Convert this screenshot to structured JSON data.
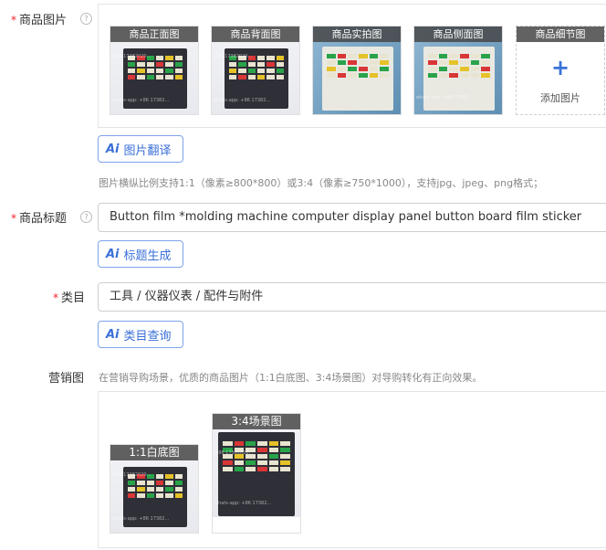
{
  "product_images": {
    "label": "商品图片",
    "help": "?",
    "items": [
      {
        "label": "商品正面图",
        "style": "white"
      },
      {
        "label": "商品背面图",
        "style": "white"
      },
      {
        "label": "商品实拍图",
        "style": "blue"
      },
      {
        "label": "商品侧面图",
        "style": "blue"
      }
    ],
    "add_tile": {
      "head": "商品细节图",
      "plus": "+",
      "text": "添加图片"
    },
    "translate_button": "图片翻译",
    "tip": "图片横纵比例支持1:1（像素≥800*800）或3:4（像素≥750*1000），支持jpg、jpeg、png格式；"
  },
  "title_field": {
    "label": "商品标题",
    "help": "?",
    "value": "Button film *molding machine computer display panel button board film sticker",
    "generate_button": "标题生成"
  },
  "category_field": {
    "label": "类目",
    "value": "工具 / 仪器仪表 / 配件与附件",
    "query_button": "类目查询"
  },
  "marketing": {
    "label": "营销图",
    "tip": "在营销导购场景，优质的商品图片（1:1白底图、3:4场景图）对导购转化有正向效果。",
    "images": [
      {
        "label": "1:1白底图"
      },
      {
        "label": "3:4场景图"
      }
    ]
  },
  "ai_icon": "Ai",
  "watermark": [
    "+86 17382020...",
    "whats-app: +86 17382..."
  ]
}
